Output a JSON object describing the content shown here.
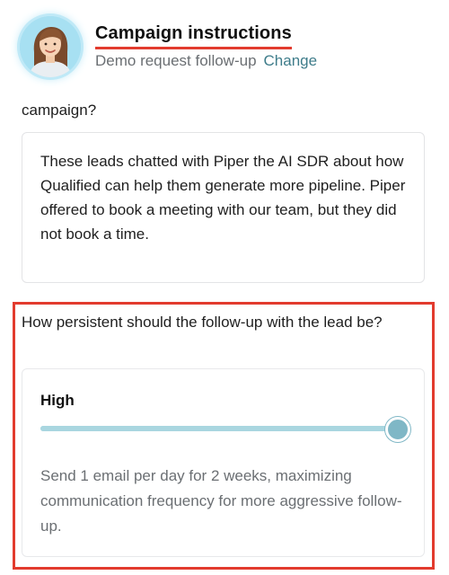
{
  "header": {
    "title": "Campaign instructions",
    "subtitle": "Demo request follow-up",
    "change_link": "Change"
  },
  "campaign_question": {
    "label": "campaign?",
    "answer": "These leads chatted with Piper the AI SDR about how Qualified can help them generate more pipeline. Piper offered to book a meeting with our team, but they did not book a time."
  },
  "persistence": {
    "question": "How persistent should the follow-up with the lead be?",
    "level": "High",
    "slider_value_fraction": 1.0,
    "description": "Send 1 email per day for 2 weeks, maximizing communication frequency for more aggressive follow-up."
  },
  "colors": {
    "accent": "#3e7c8a",
    "highlight_border": "#e23b2e",
    "slider_thumb": "#7fb7c6",
    "slider_track": "#b9e0e8"
  }
}
